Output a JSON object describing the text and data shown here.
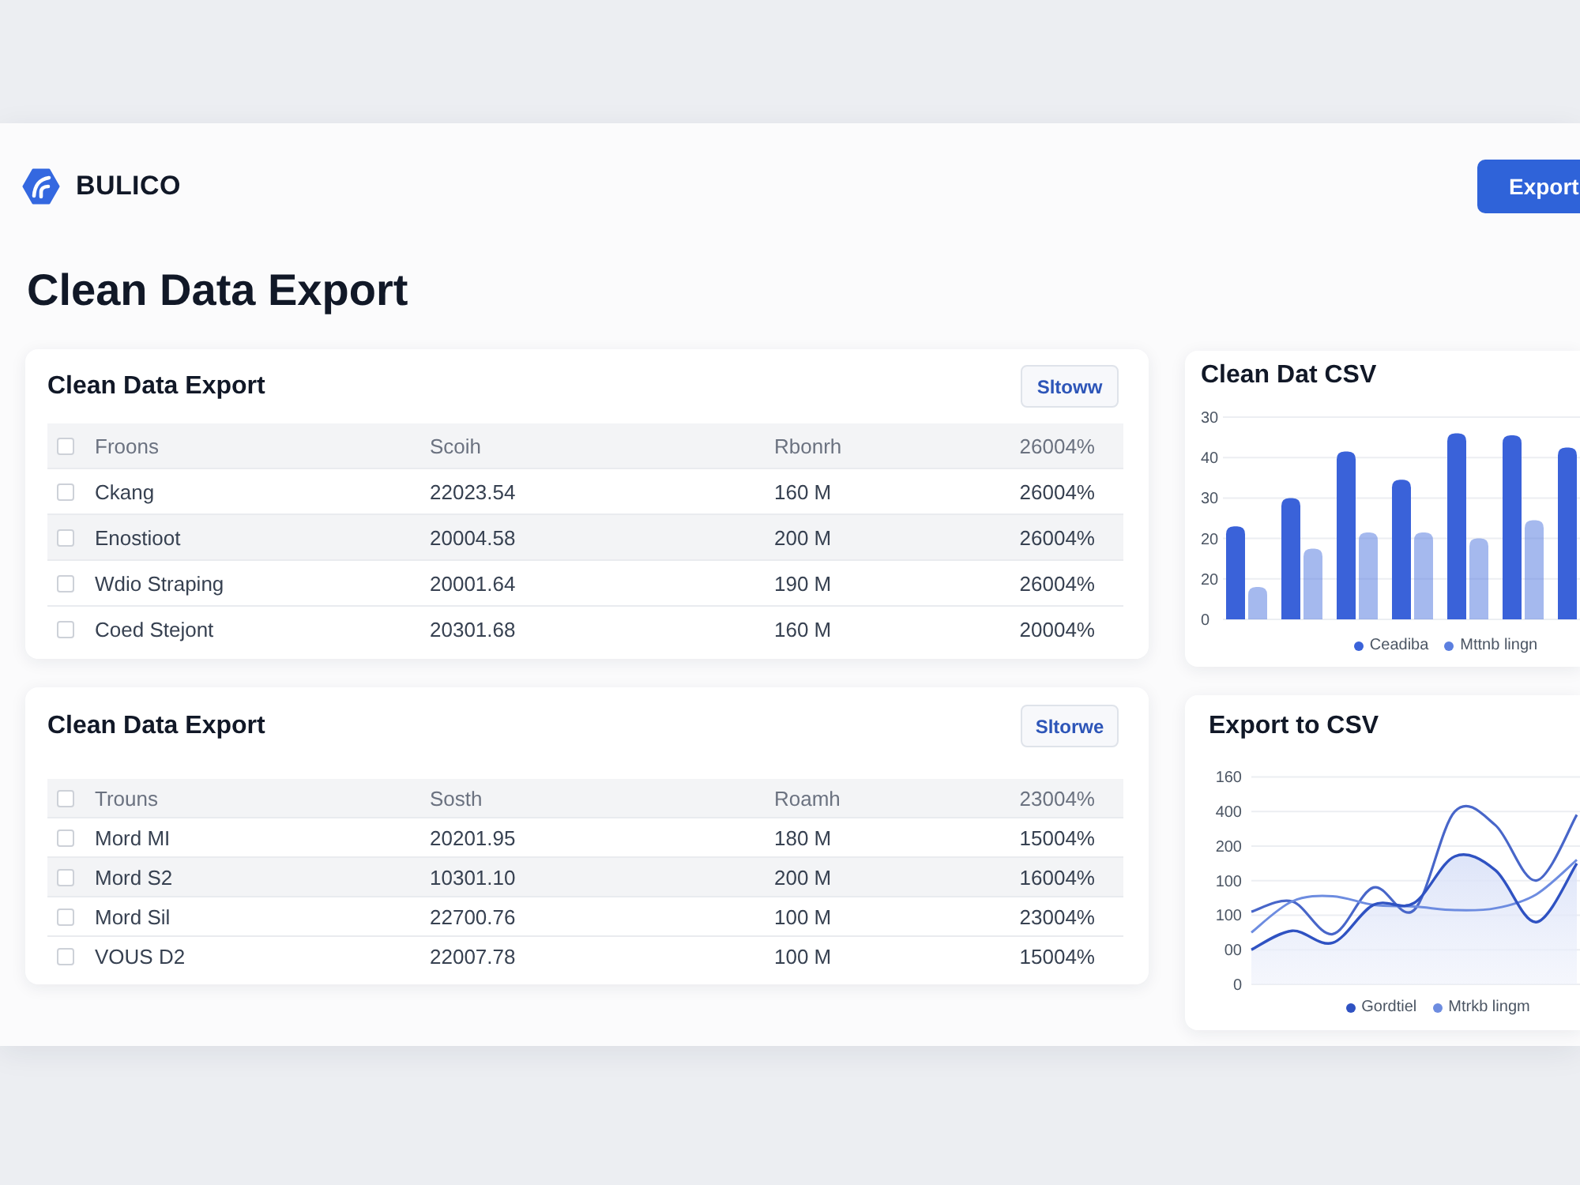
{
  "header": {
    "logo_text": "BULICO",
    "export_button": "Export"
  },
  "title": "Clean Data Export",
  "tables": [
    {
      "title": "Clean Data Export",
      "button": "Sltoww",
      "header": {
        "checked": false,
        "columns": [
          "Froons",
          "Scoih",
          "Rbonrh",
          "26004%"
        ]
      },
      "rows": [
        {
          "checked": false,
          "highlighted": false,
          "cells": [
            "Ckang",
            "22023.54",
            "160 M",
            "26004%"
          ]
        },
        {
          "checked": false,
          "highlighted": true,
          "cells": [
            "Enostioot",
            "20004.58",
            "200 M",
            "26004%"
          ]
        },
        {
          "checked": false,
          "highlighted": false,
          "cells": [
            "Wdio Straping",
            "20001.64",
            "190 M",
            "26004%"
          ]
        },
        {
          "checked": false,
          "highlighted": false,
          "cells": [
            "Coed Stejont",
            "20301.68",
            "160 M",
            "20004%"
          ]
        }
      ]
    },
    {
      "title": "Clean Data Export",
      "button": "Sltorwe",
      "header": {
        "checked": false,
        "columns": [
          "Trouns",
          "Sosth",
          "Roamh",
          "23004%"
        ]
      },
      "rows": [
        {
          "checked": false,
          "highlighted": false,
          "cells": [
            "Mord MI",
            "20201.95",
            "180 M",
            "15004%"
          ]
        },
        {
          "checked": false,
          "highlighted": true,
          "cells": [
            "Mord S2",
            "10301.10",
            "200 M",
            "16004%"
          ]
        },
        {
          "checked": false,
          "highlighted": false,
          "cells": [
            "Mord Sil",
            "22700.76",
            "100 M",
            "23004%"
          ]
        },
        {
          "checked": false,
          "highlighted": false,
          "cells": [
            "VOUS D2",
            "22007.78",
            "100 M",
            "15004%"
          ]
        }
      ]
    }
  ],
  "charts": [
    {
      "title": "Clean Dat CSV",
      "kind": "bar",
      "y_axis_labels": [
        "30",
        "40",
        "30",
        "20",
        "20",
        "0"
      ],
      "legend": [
        {
          "label": "Ceadiba",
          "color": "#3a62d9"
        },
        {
          "label": "Mttnb lingn",
          "color": "#5b7fe0"
        }
      ]
    },
    {
      "title": "Export to CSV",
      "kind": "line",
      "y_axis_labels": [
        "160",
        "400",
        "200",
        "100",
        "100",
        "00",
        "0"
      ],
      "legend": [
        {
          "label": "Gordtiel",
          "color": "#2f52c2"
        },
        {
          "label": "Mtrkb lingm",
          "color": "#6d8ce0"
        }
      ]
    }
  ]
}
